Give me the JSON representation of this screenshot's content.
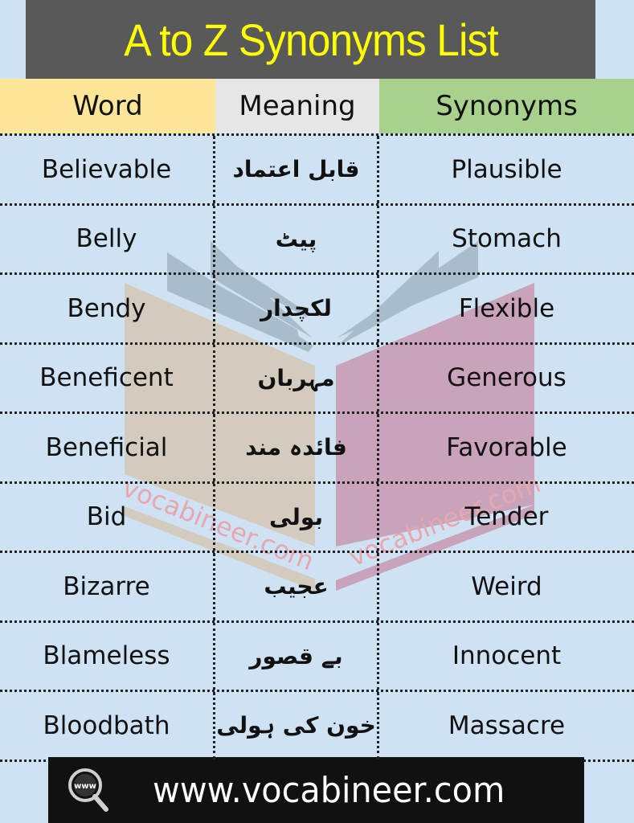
{
  "title": "A to Z Synonyms List",
  "header": {
    "word": "Word",
    "meaning": "Meaning",
    "synonyms": "Synonyms"
  },
  "rows": [
    {
      "word": "Believable",
      "meaning": "قابل اعتماد",
      "synonym": "Plausible"
    },
    {
      "word": "Belly",
      "meaning": "پیٹ",
      "synonym": "Stomach"
    },
    {
      "word": "Bendy",
      "meaning": "لکچدار",
      "synonym": "Flexible"
    },
    {
      "word": "Beneficent",
      "meaning": "مہربان",
      "synonym": "Generous"
    },
    {
      "word": "Beneficial",
      "meaning": "فائدہ مند",
      "synonym": "Favorable"
    },
    {
      "word": "Bid",
      "meaning": "بولی",
      "synonym": "Tender"
    },
    {
      "word": "Bizarre",
      "meaning": "عجیب",
      "synonym": "Weird"
    },
    {
      "word": "Blameless",
      "meaning": "بے قصور",
      "synonym": "Innocent"
    },
    {
      "word": "Bloodbath",
      "meaning": "خون کی ہولی",
      "synonym": "Massacre"
    }
  ],
  "watermark": {
    "text_left": "vocabineer.com",
    "text_right": "vocabineer.com",
    "icon": "open-book-icon"
  },
  "footer": {
    "icon": "www-search-icon",
    "icon_label": "www",
    "url": "www.vocabineer.com"
  },
  "colors": {
    "title_bg": "#595959",
    "title_text": "#ffff00",
    "word_header": "#ffe597",
    "meaning_header": "#e6e6e6",
    "synonyms_header": "#a9d18e",
    "page_bg": "#cfe2f3",
    "footer_bg": "#111112"
  }
}
